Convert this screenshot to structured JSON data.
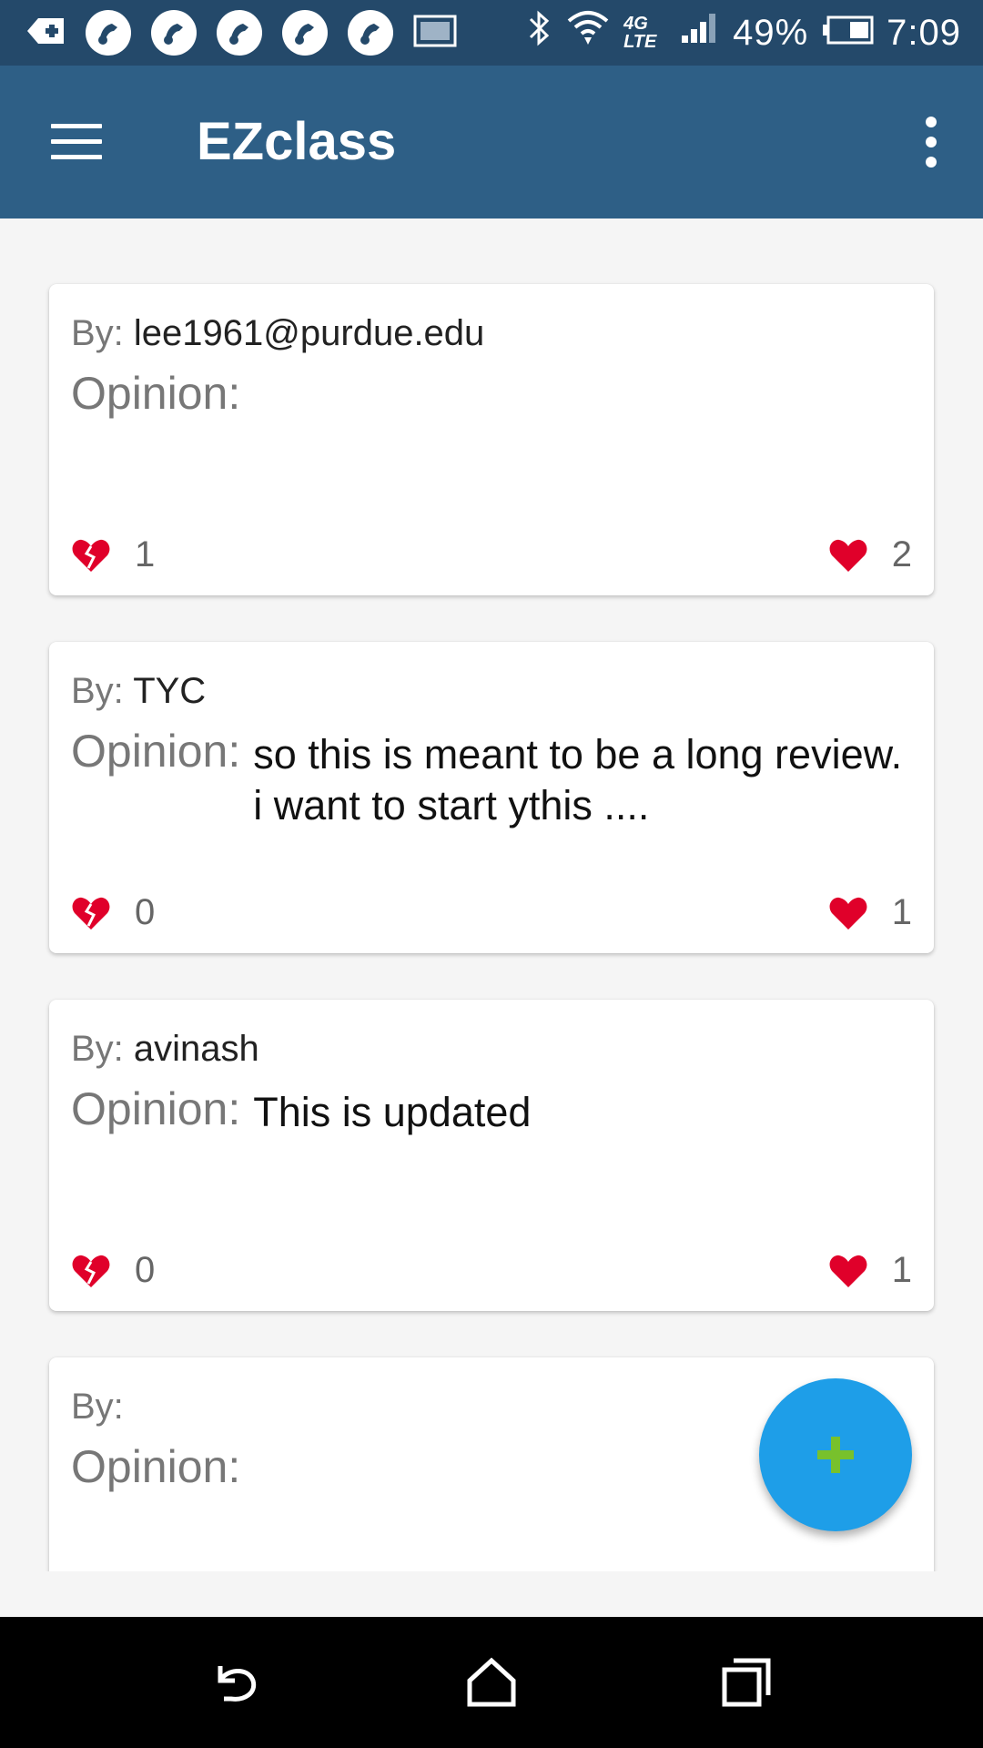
{
  "status_bar": {
    "battery": "49%",
    "time": "7:09",
    "network": "4G LTE",
    "icons": [
      "add-box-icon",
      "app-bubble-icon",
      "app-bubble-icon",
      "app-bubble-icon",
      "app-bubble-icon",
      "app-bubble-icon",
      "image-icon",
      "bluetooth-icon",
      "wifi-icon",
      "signal-icon",
      "battery-icon"
    ]
  },
  "app_bar": {
    "title": "EZclass",
    "menu_icon": "hamburger-menu-icon",
    "overflow_icon": "more-vert-icon"
  },
  "labels": {
    "by": "By:",
    "opinion": "Opinion:"
  },
  "reviews": [
    {
      "author": "lee1961@purdue.edu",
      "opinion": "",
      "dislikes": "1",
      "likes": "2"
    },
    {
      "author": "TYC",
      "opinion": "so this is meant to be a long review. i want to start ythis ....",
      "dislikes": "0",
      "likes": "1"
    },
    {
      "author": "avinash",
      "opinion": "This is updated",
      "dislikes": "0",
      "likes": "1"
    },
    {
      "author": "",
      "opinion": ""
    }
  ],
  "fab": {
    "icon": "add-icon"
  },
  "nav_bar": {
    "icons": [
      "back-icon",
      "home-icon",
      "recents-icon"
    ]
  },
  "colors": {
    "status_bar": "#24496a",
    "app_bar": "#2e5f86",
    "heart": "#e0002a",
    "fab": "#1e9ee8",
    "fab_plus": "#78c12c"
  }
}
